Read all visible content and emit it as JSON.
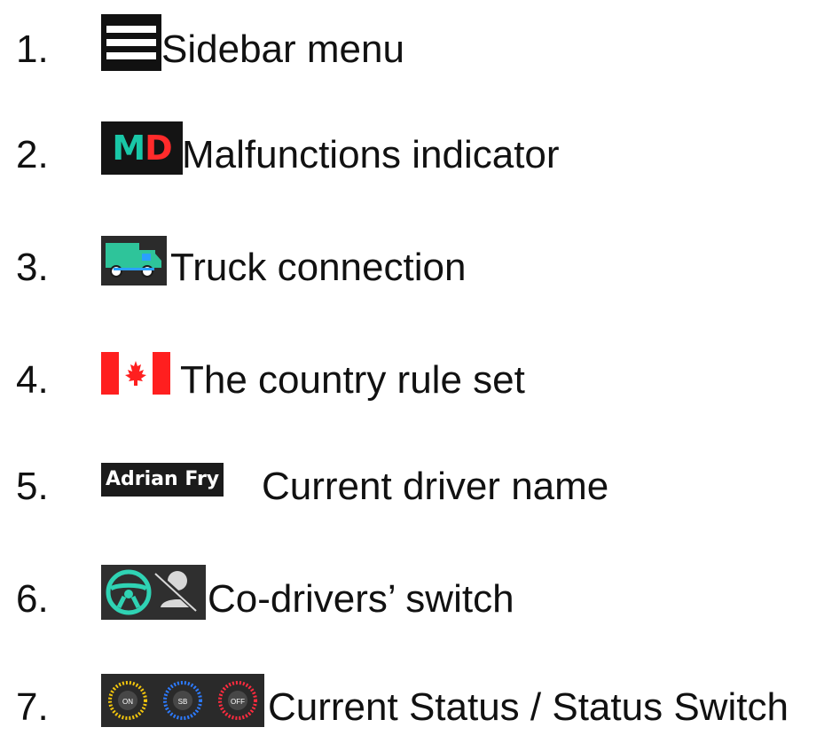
{
  "items": [
    {
      "number": "1.",
      "label": "Sidebar menu",
      "icon": "hamburger-menu-icon"
    },
    {
      "number": "2.",
      "label": "Malfunctions indicator",
      "icon": "malfunctions-md-icon",
      "icon_text_m": "M",
      "icon_text_d": "D",
      "colors": {
        "m": "#19c7a7",
        "d": "#ff2b2b"
      }
    },
    {
      "number": "3.",
      "label": "Truck connection",
      "icon": "truck-connection-icon",
      "colors": {
        "truck": "#2ec49a",
        "accent": "#2aa0ff"
      }
    },
    {
      "number": "4.",
      "label": "The country rule set",
      "icon": "canada-flag-icon",
      "colors": {
        "red": "#ff1f1f"
      }
    },
    {
      "number": "5.",
      "label": "Current driver name",
      "icon": "driver-name-badge",
      "icon_text": "Adrian Fry"
    },
    {
      "number": "6.",
      "label": "Co-drivers’ switch",
      "icon": "co-drivers-switch-icon",
      "colors": {
        "wheel": "#2fd3b4",
        "person": "#d8d8d8"
      }
    },
    {
      "number": "7.",
      "label": "Current Status / Status Switch",
      "icon": "status-switch-icon",
      "status_buttons": [
        "ON",
        "SB",
        "OFF"
      ],
      "colors": {
        "on": "#f2c50d",
        "sb": "#2d7bff",
        "off": "#ff2b3f"
      }
    }
  ]
}
